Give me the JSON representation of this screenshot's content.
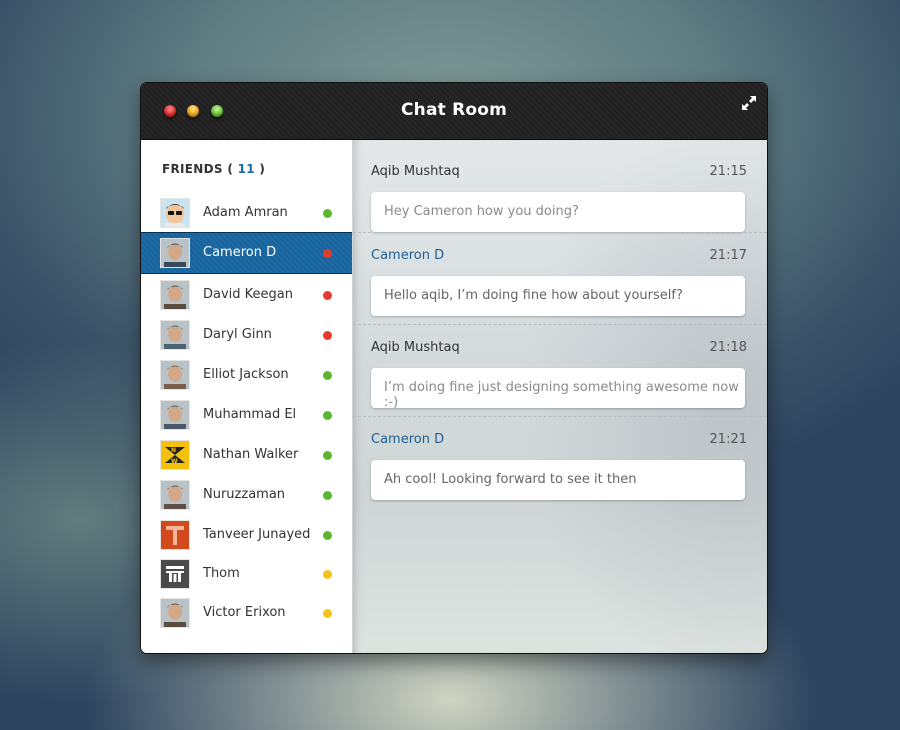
{
  "window": {
    "title": "Chat Room",
    "controls": [
      "close",
      "minimize",
      "maximize"
    ],
    "expand_icon": "expand-arrows-icon"
  },
  "sidebar": {
    "heading": "FRIENDS",
    "count": "11",
    "friends": [
      {
        "name": "Adam Amran",
        "status": "online",
        "status_color": "#5cb82a",
        "avatar": "cartoon-sunglasses"
      },
      {
        "name": "Cameron D",
        "status": "busy",
        "status_color": "#e53a2f",
        "avatar": "photo",
        "selected": true
      },
      {
        "name": "David Keegan",
        "status": "busy",
        "status_color": "#e53a2f",
        "avatar": "photo"
      },
      {
        "name": "Daryl Ginn",
        "status": "busy",
        "status_color": "#e53a2f",
        "avatar": "photo"
      },
      {
        "name": "Elliot Jackson",
        "status": "online",
        "status_color": "#5cb82a",
        "avatar": "photo"
      },
      {
        "name": "Muhammad El",
        "status": "online",
        "status_color": "#5cb82a",
        "avatar": "photo"
      },
      {
        "name": "Nathan Walker",
        "status": "online",
        "status_color": "#5cb82a",
        "avatar": "nw-logo"
      },
      {
        "name": "Nuruzzaman",
        "status": "online",
        "status_color": "#5cb82a",
        "avatar": "photo"
      },
      {
        "name": "Tanveer Junayed",
        "status": "online",
        "status_color": "#5cb82a",
        "avatar": "t-logo"
      },
      {
        "name": "Thom",
        "status": "away",
        "status_color": "#f5c21c",
        "avatar": "tt-logo"
      },
      {
        "name": "Victor Erixon",
        "status": "away",
        "status_color": "#f5c21c",
        "avatar": "photo"
      }
    ]
  },
  "chat": {
    "messages": [
      {
        "sender": "Aqib Mushtaq",
        "time": "21:15",
        "text": "Hey Cameron how you doing?",
        "is_me": false
      },
      {
        "sender": "Cameron D",
        "time": "21:17",
        "text": "Hello aqib, I’m doing fine how about yourself?",
        "is_me": true
      },
      {
        "sender": "Aqib Mushtaq",
        "time": "21:18",
        "text": "I’m doing fine just designing something awesome now :-)",
        "is_me": false
      },
      {
        "sender": "Cameron D",
        "time": "21:21",
        "text": "Ah cool! Looking forward to see it then",
        "is_me": true
      }
    ],
    "composer": {
      "value": "",
      "placeholder": "",
      "emoji_icon": "smiley-icon"
    }
  },
  "colors": {
    "accent": "#1e6aa6",
    "online": "#5cb82a",
    "busy": "#e53a2f",
    "away": "#f5c21c"
  }
}
